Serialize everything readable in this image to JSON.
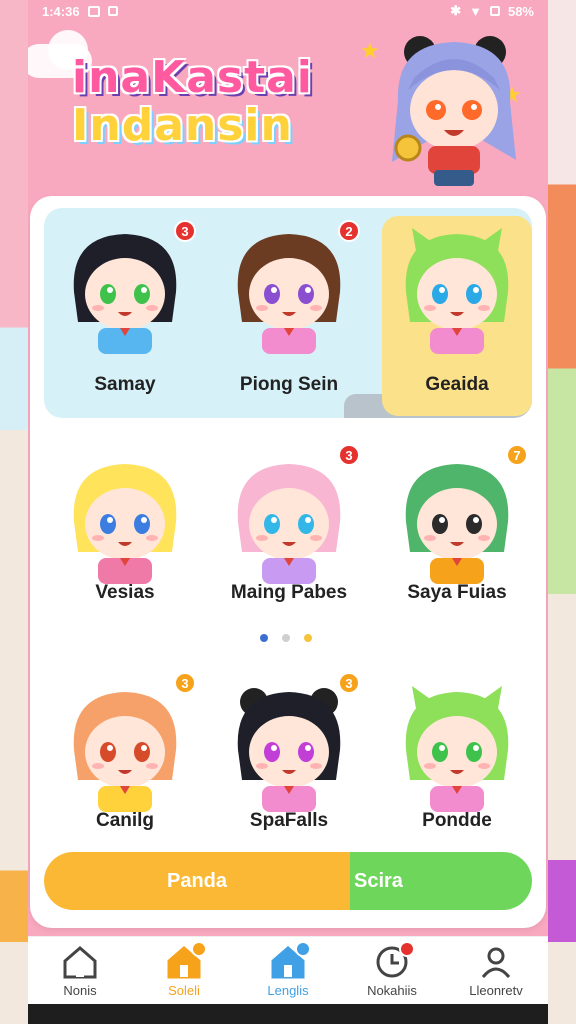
{
  "status_bar": {
    "time": "1:4:36",
    "battery": "58%"
  },
  "app": {
    "logo_line1": "inaKastai",
    "logo_line2": "Indansin"
  },
  "characters": [
    {
      "name": "Samay",
      "badge": "3",
      "badge_color": "#e5322f",
      "hair": "#1f1f2a",
      "eyes": "#3ec24b",
      "shirt": "#57b6f0"
    },
    {
      "name": "Piong Sein",
      "badge": "2",
      "badge_color": "#e5322f",
      "hair": "#6b3b22",
      "eyes": "#8a4fd1",
      "shirt": "#f38bcf"
    },
    {
      "name": "Geaida",
      "badge": "",
      "badge_color": "",
      "hair": "#8ee05a",
      "eyes": "#2aa9e6",
      "shirt": "#f38bcf"
    },
    {
      "name": "Vesias",
      "badge": "",
      "badge_color": "",
      "hair": "#ffe35a",
      "eyes": "#3b7de0",
      "shirt": "#f07aa7"
    },
    {
      "name": "Maing Pabes",
      "badge": "3",
      "badge_color": "#e5322f",
      "hair": "#f8b6d2",
      "eyes": "#33b6e8",
      "shirt": "#c99af2"
    },
    {
      "name": "Saya Fuias",
      "badge": "7",
      "badge_color": "#f7a21b",
      "hair": "#4fb56a",
      "eyes": "#2b2b2b",
      "shirt": "#f7a21b"
    },
    {
      "name": "Canilg",
      "badge": "3",
      "badge_color": "#f7a21b",
      "hair": "#f7a16a",
      "eyes": "#d64b2a",
      "shirt": "#ffd23c"
    },
    {
      "name": "SpaFalls",
      "badge": "3",
      "badge_color": "#f7a21b",
      "hair": "#1f1f2a",
      "eyes": "#c13fd6",
      "shirt": "#f38bcf"
    },
    {
      "name": "Pondde",
      "badge": "",
      "badge_color": "",
      "hair": "#8ee05a",
      "eyes": "#3ec24b",
      "shirt": "#f38bcf"
    }
  ],
  "pager": {
    "dots": [
      "#3a6fd0",
      "#cfcfcf",
      "#f5c43a"
    ]
  },
  "split_button": {
    "left_label": "Panda",
    "right_label": "Scira"
  },
  "nav": [
    {
      "label": "Nonis",
      "icon": "house-outline-icon",
      "color": "#444",
      "badge": ""
    },
    {
      "label": "Soleli",
      "icon": "house-orange-icon",
      "color": "#f7a21b",
      "badge": "dot"
    },
    {
      "label": "Lenglis",
      "icon": "house-blue-icon",
      "color": "#3fa0e6",
      "badge": "dot"
    },
    {
      "label": "Nokahiis",
      "icon": "clock-icon",
      "color": "#444",
      "badge": "dot"
    },
    {
      "label": "Lleonretv",
      "icon": "user-icon",
      "color": "#444",
      "badge": ""
    }
  ]
}
